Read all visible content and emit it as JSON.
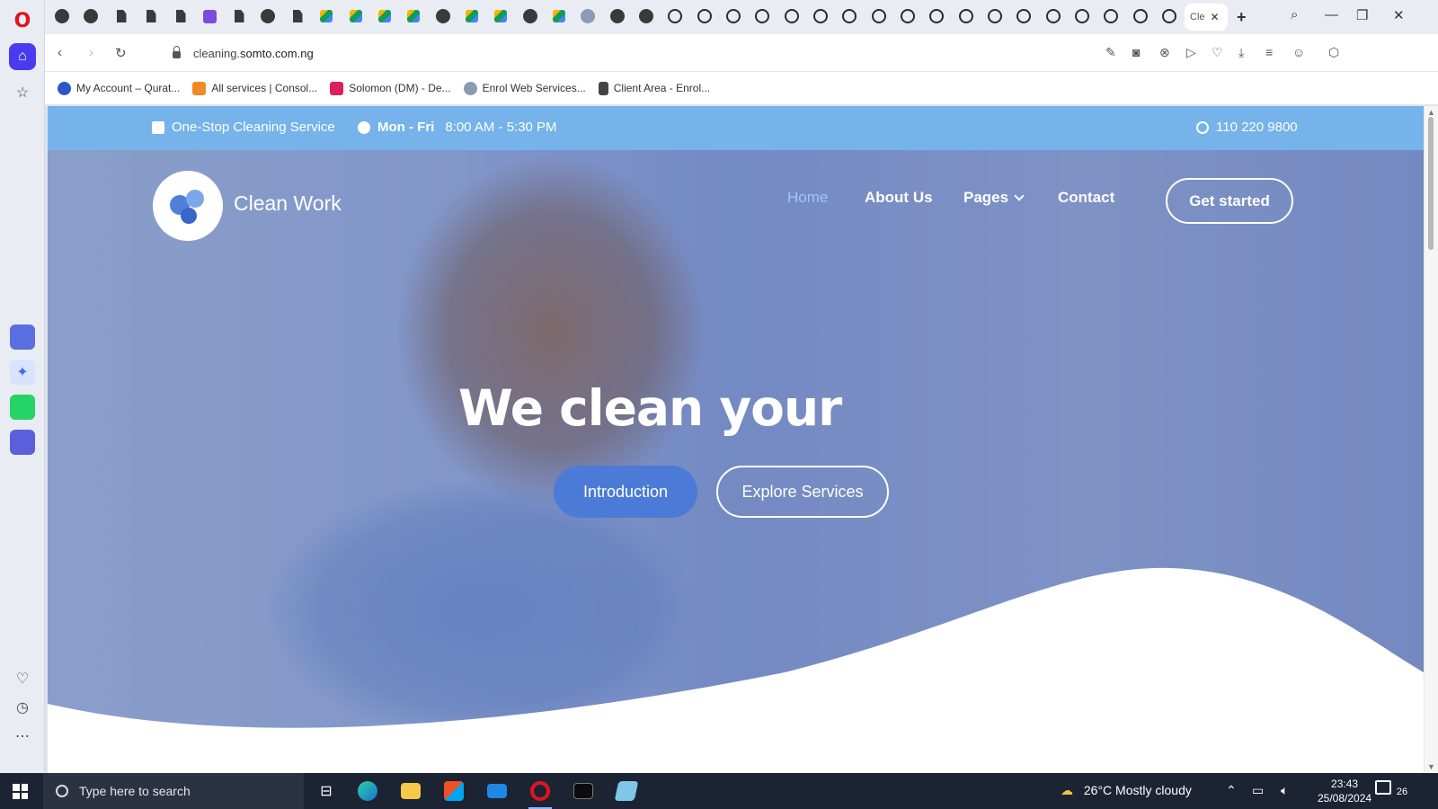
{
  "browser": {
    "active_tab_title": "Cle",
    "url_prefix": "cleaning.",
    "url_domain": "somto.com.ng",
    "bookmarks": [
      {
        "label": "My Account – Qurat...",
        "color": "#2a56c6"
      },
      {
        "label": "All services | Consol...",
        "color": "#f08a24"
      },
      {
        "label": "Solomon (DM) - De...",
        "color": "#e01e5a"
      },
      {
        "label": "Enrol Web Services...",
        "color": "#8a9bb3"
      },
      {
        "label": "Client Area - Enrol...",
        "color": "#444444"
      }
    ]
  },
  "site": {
    "topbar": {
      "service": "One-Stop Cleaning Service",
      "days": "Mon - Fri",
      "hours": "8:00 AM - 5:30 PM",
      "phone": "110 220 9800"
    },
    "brand": "Clean Work",
    "nav": {
      "home": "Home",
      "about": "About Us",
      "pages": "Pages",
      "contact": "Contact"
    },
    "cta": "Get started",
    "headline": "We clean your",
    "btn_intro": "Introduction",
    "btn_explore": "Explore Services"
  },
  "taskbar": {
    "search_placeholder": "Type here to search",
    "weather": "26°C  Mostly cloudy",
    "time": "23:43",
    "date": "25/08/2024",
    "notifications": "26"
  },
  "colors": {
    "topbar": "#75b3ea",
    "primary_button": "#4c7bd7",
    "nav_active": "#9ec8f5",
    "taskbar": "#1c2433"
  }
}
